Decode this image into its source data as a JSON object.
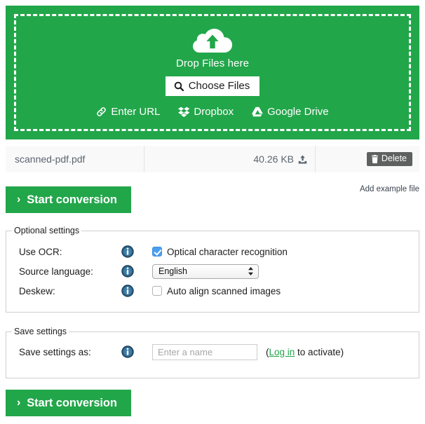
{
  "theme": {
    "brand_green": "#22a64a",
    "checkbox_blue": "#4a9ef0",
    "info_navy": "#2b5c7e",
    "delete_gray": "#5f6060",
    "row_bg": "#f9f9f9"
  },
  "dropzone": {
    "upload_icon": "cloud-upload-icon",
    "drop_label": "Drop Files here",
    "choose_files_label": "Choose Files",
    "choose_files_icon": "magnifier-icon",
    "services": [
      {
        "label": "Enter URL",
        "icon": "link-icon"
      },
      {
        "label": "Dropbox",
        "icon": "dropbox-icon"
      },
      {
        "label": "Google Drive",
        "icon": "google-drive-icon"
      }
    ]
  },
  "file_row": {
    "name": "scanned-pdf.pdf",
    "size": "40.26 KB",
    "size_icon": "upload-arrow-icon",
    "delete_label": "Delete",
    "delete_icon": "trash-icon"
  },
  "actions": {
    "start_conversion_label": "Start conversion",
    "chevron": "›",
    "add_example_label": "Add example file"
  },
  "optional_settings": {
    "legend": "Optional settings",
    "rows": [
      {
        "label": "Use OCR:",
        "info_icon": "info-icon",
        "control": "checkbox",
        "checked": true,
        "control_label": "Optical character recognition"
      },
      {
        "label": "Source language:",
        "info_icon": "info-icon",
        "control": "select",
        "value": "English",
        "options": [
          "English"
        ]
      },
      {
        "label": "Deskew:",
        "info_icon": "info-icon",
        "control": "checkbox",
        "checked": false,
        "control_label": "Auto align scanned images"
      }
    ]
  },
  "save_settings": {
    "legend": "Save settings",
    "label": "Save settings as:",
    "info_icon": "info-icon",
    "input_placeholder": "Enter a name",
    "input_value": "",
    "note_open": "(",
    "login_label": "Log in",
    "note_close": " to activate)"
  }
}
